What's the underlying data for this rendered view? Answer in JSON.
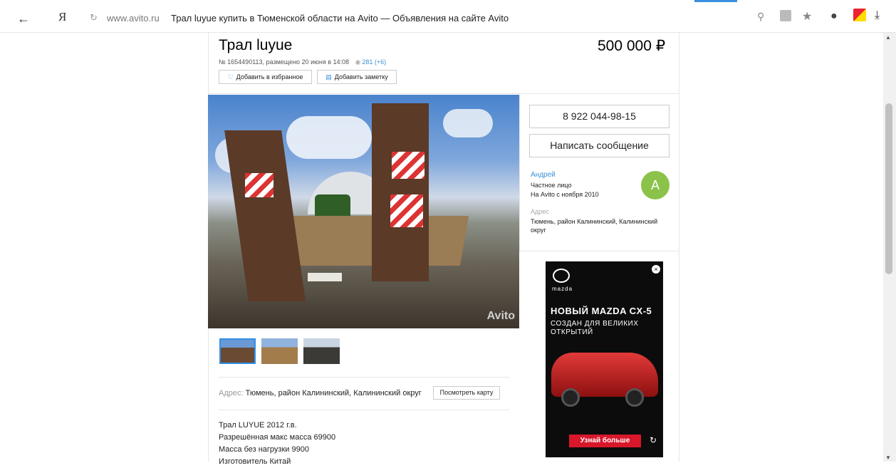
{
  "browser": {
    "back_icon": "←",
    "logo": "Я",
    "reload_icon": "↻",
    "url_domain": "www.avito.ru",
    "page_title": "Трал luyue купить в Тюменской области на Avito — Объявления на сайте Avito",
    "search_icon": "⚲",
    "star_icon": "★",
    "ghost_icon": "●",
    "download_icon": "⤓"
  },
  "listing": {
    "title": "Трал luyue",
    "price": "500 000 ₽",
    "meta_text": "№ 1654490113, размещено 20 июня в 14:08",
    "views_icon": "◉",
    "views_count": "281 (+6)",
    "fav_icon": "♡",
    "fav_label": "Добавить в избранное",
    "note_icon": "▤",
    "note_label": "Добавить заметку",
    "photo_watermark": "Avito",
    "address_label": "Адрес:",
    "address_value": "Тюмень, район Калининский, Калининский округ",
    "map_button": "Посмотреть карту",
    "description": [
      "Трал LUYUE 2012 г.в.",
      "Разрешённая макс масса 69900",
      "Масса без нагрузки 9900",
      "Изготовитель Китай"
    ]
  },
  "seller": {
    "phone_button": "8 922 044-98-15",
    "message_button": "Написать сообщение",
    "name": "Андрей",
    "type": "Частное лицо",
    "since": "На Avito с ноября 2010",
    "avatar_letter": "А",
    "address_label": "Адрес",
    "address": "Тюмень, район Калининский, Калининский округ"
  },
  "ad": {
    "close_icon": "×",
    "brand": "mazda",
    "title": "НОВЫЙ MAZDA CX-5",
    "subtitle": "СОЗДАН ДЛЯ ВЕЛИКИХ ОТКРЫТИЙ",
    "cta": "Узнай больше",
    "replay_icon": "↻"
  },
  "colors": {
    "link": "#3a8fd8",
    "avatar": "#8bc34a",
    "ad_cta": "#d8172b",
    "thumb_selected": "#2f8fe6"
  }
}
